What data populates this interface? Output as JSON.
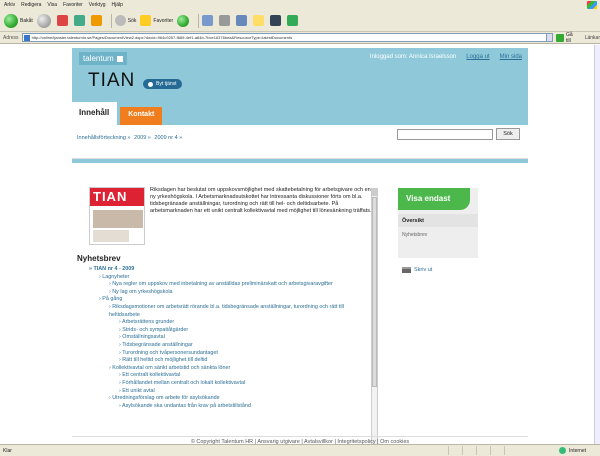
{
  "browser": {
    "menu": [
      "Arkiv",
      "Redigera",
      "Visa",
      "Favoriter",
      "Verktyg",
      "Hjälp"
    ],
    "toolbar": {
      "back_label": "Bakåt",
      "search_label": "Sök",
      "favorites_label": "Favoriter"
    },
    "address_label": "Adress",
    "address_url": "http://online/tjanster.talentumhr.se/Pages/DocumentView2.aspx?docid=964c9257-f689-4ef1-a84b-7bce16376bea&ResourceType=latestDocuments",
    "go_label": "Gå till",
    "links_label": "Länkar",
    "status_text": "Klar",
    "zone_label": "Internet"
  },
  "site": {
    "brand": "talentum",
    "logged_in": "Inloggad som: Annica Israelsson",
    "logout_label": "Logga ut",
    "my_page_label": "Min sida",
    "logo": "TIAN",
    "switch_service_label": "Byt tjänst",
    "tab_content": "Innehåll",
    "tab_contact": "Kontakt",
    "breadcrumb": [
      "Innehållsförteckning »",
      "2009 »",
      "2009 nr 4 »"
    ],
    "search_button": "Sök",
    "magazine_title": "TIAN",
    "intro": "Riksdagen har beslutat om uppskovsmöjlighet med skattebetalning för arbetsgivare och en ny yrkeshögskola. I Arbetsmarknadsutskottet har intressanta diskussioner förts om bl.a. tidsbegränsade anställningar, turordning och rätt till hel- och deltidsarbete. På arbetsmarknaden har ett unikt centralt kollektivavtal med möjlighet till lönesänkning träffats.",
    "section_title": "Nyhetsbrev",
    "tree": [
      {
        "level": 1,
        "text": "» TIAN nr 4 - 2009"
      },
      {
        "level": 2,
        "text": "› Lagnyheter"
      },
      {
        "level": 3,
        "text": "› Nya regler om uppskov med inbetalning av anställdas preliminärskatt och arbetsgivaravgifter"
      },
      {
        "level": 3,
        "text": "› Ny lag om yrkeshögskola"
      },
      {
        "level": 2,
        "text": "› På gång"
      },
      {
        "level": 3,
        "text": "› Riksdagsmotioner om arbetsrätt rörande bl.a. tidsbegränsade anställningar, turordning och rätt till heltidsarbete"
      },
      {
        "level": 4,
        "text": "› Arbetsrättens grunder"
      },
      {
        "level": 4,
        "text": "› Strids- och sympatiåtgärder"
      },
      {
        "level": 4,
        "text": "› Omställningsavtal"
      },
      {
        "level": 4,
        "text": "› Tidsbegränsade anställningar"
      },
      {
        "level": 4,
        "text": "› Turordning och tvåpersonersundantaget"
      },
      {
        "level": 4,
        "text": "› Rätt till heltid och möjlighet till deltid"
      },
      {
        "level": 3,
        "text": "› Kollektivavtal om sänkt arbetstid och sänkta löner"
      },
      {
        "level": 4,
        "text": "› Ett centralt kollektivavtal"
      },
      {
        "level": 4,
        "text": "› Förhållandet mellan centralt och lokalt kollektivavtal"
      },
      {
        "level": 4,
        "text": "› Ett unikt avtal"
      },
      {
        "level": 3,
        "text": "› Utredningsförslag om arbete för asylsökande"
      },
      {
        "level": 4,
        "text": "› Asylsökande ska undantas från krav på arbetstillstånd"
      }
    ],
    "show_only_label": "Visa endast",
    "overview_label": "Översikt",
    "newsletter_label": "Nyhetsbrev",
    "print_label": "Skriv ut",
    "footer": "© Copyright Talentum HR  |  Ansvarig utgivare  |  Avtalsvillkor  |  Integritetspolicy  |  Om cookies"
  },
  "colors": {
    "header_bg": "#8fc9d9",
    "contact_tab": "#f07e1e",
    "visa_endast": "#4cb84c",
    "link": "#2b6f95"
  }
}
